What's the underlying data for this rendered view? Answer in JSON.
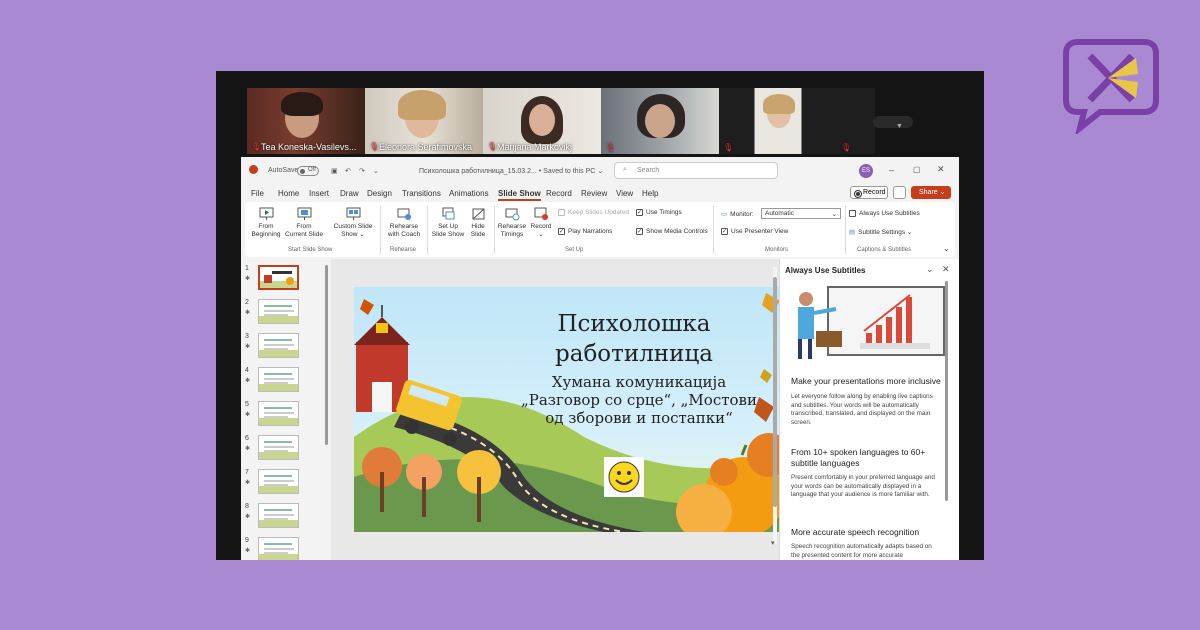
{
  "participants": [
    {
      "name": "Tea Koneska-Vasilevs...",
      "muted": true,
      "active": false
    },
    {
      "name": "Eleonora Serafimovska",
      "muted": true,
      "active": true
    },
    {
      "name": "Marijana Markovikj",
      "muted": true,
      "active": false
    },
    {
      "name": "",
      "muted": true,
      "active": false
    },
    {
      "name": "",
      "muted": true,
      "active": false
    }
  ],
  "titlebar": {
    "autosave": "AutoSave",
    "autosave_state": "Off",
    "file": "Психолошка работилница_15.03.2... • Saved to this PC ⌄",
    "search_placeholder": "Search",
    "avatar": "ES"
  },
  "menu": [
    "File",
    "Home",
    "Insert",
    "Draw",
    "Design",
    "Transitions",
    "Animations",
    "Slide Show",
    "Record",
    "Review",
    "View",
    "Help"
  ],
  "menu_active": "Slide Show",
  "actions": {
    "record": "Record",
    "share": "Share ⌄"
  },
  "ribbon": {
    "from_beginning": [
      "From",
      "Beginning"
    ],
    "from_current": [
      "From",
      "Current Slide"
    ],
    "custom_show": [
      "Custom Slide",
      "Show ⌄"
    ],
    "group_start": "Start Slide Show",
    "rehearse_coach": [
      "Rehearse",
      "with Coach"
    ],
    "group_rehearse": "Rehearse",
    "set_up_show": [
      "Set Up",
      "Slide Show"
    ],
    "hide_slide": [
      "Hide",
      "Slide"
    ],
    "rehearse_timings": [
      "Rehearse",
      "Timings"
    ],
    "record": [
      "Record",
      "⌄"
    ],
    "keep_updated": "Keep Slides Updated",
    "play_narrations": "Play Narrations",
    "use_timings": "Use Timings",
    "show_media": "Show Media Controls",
    "group_setup": "Set Up",
    "monitor_label": "Monitor:",
    "monitor_value": "Automatic",
    "presenter_view": "Use Presenter View",
    "group_monitors": "Monitors",
    "always_subtitles": "Always Use Subtitles",
    "subtitle_settings": "Subtitle Settings ⌄",
    "group_captions": "Captions & Subtitles"
  },
  "slides": [
    "1",
    "2",
    "3",
    "4",
    "5",
    "6",
    "7",
    "8",
    "9"
  ],
  "slide": {
    "title_line1": "Психолошка",
    "title_line2": "работилница",
    "sub_line1": "Хумана комуникација",
    "sub_line2": "„Разговор со срце“, „Мостови",
    "sub_line3": "од зборови и постапки“"
  },
  "pane": {
    "title": "Always Use Subtitles",
    "h1": "Make your presentations more inclusive",
    "p1": "Let everyone follow along by enabling live captions and subtitles. Your words will be automatically transcribed, translated, and displayed on the main screen.",
    "h2": "From 10+ spoken languages to 60+ subtitle languages",
    "p2": "Present comfortably in your preferred language and your words can be automatically displayed in a language that your audience is more familiar with.",
    "h3": "More accurate speech recognition",
    "p3": "Speech recognition automatically adapts based on the presented content for more accurate"
  }
}
